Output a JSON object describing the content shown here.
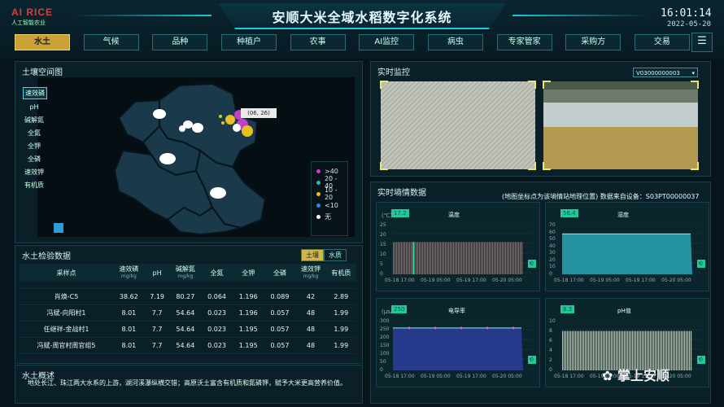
{
  "header": {
    "brand": "AI RICE",
    "brand_sub": "人工智能农业",
    "title": "安顺大米全域水稻数字化系统",
    "time": "16:01:14",
    "date": "2022-05-20"
  },
  "nav": {
    "tabs": [
      "水土",
      "气候",
      "品种",
      "种植户",
      "农事",
      "AI监控",
      "病虫",
      "专家管家",
      "采购方",
      "交易"
    ],
    "active": "水土"
  },
  "soil_map": {
    "title": "土壤空间图",
    "layers": [
      "速效磷",
      "pH",
      "碱解氮",
      "全氮",
      "全钾",
      "全磷",
      "速效钾",
      "有机质"
    ],
    "active_layer": "速效磷",
    "tooltip": "(06, 26)",
    "legend": [
      {
        "label": ">40",
        "color": "#c040c8"
      },
      {
        "label": "20 - 40",
        "color": "#20c0a0"
      },
      {
        "label": "10 - 20",
        "color": "#e8c020"
      },
      {
        "label": "<10",
        "color": "#2090e0"
      },
      {
        "label": "无",
        "color": "#ffffff"
      }
    ]
  },
  "soil_table": {
    "title": "水土检验数据",
    "toggle": [
      "土壤",
      "水质"
    ],
    "headers": [
      {
        "label": "采样点",
        "unit": ""
      },
      {
        "label": "速效磷",
        "unit": "mg/kg"
      },
      {
        "label": "pH",
        "unit": ""
      },
      {
        "label": "碱解氮",
        "unit": "mg/kg"
      },
      {
        "label": "全氮",
        "unit": ""
      },
      {
        "label": "全钾",
        "unit": ""
      },
      {
        "label": "全磷",
        "unit": ""
      },
      {
        "label": "速效钾",
        "unit": "mg/kg"
      },
      {
        "label": "有机质",
        "unit": ""
      }
    ],
    "rows": [
      [
        "肖焕-C5",
        "38.62",
        "7.19",
        "80.27",
        "0.064",
        "1.196",
        "0.089",
        "42",
        "2.89"
      ],
      [
        "冯斌-向阳村1",
        "8.01",
        "7.7",
        "54.64",
        "0.023",
        "1.196",
        "0.057",
        "48",
        "1.99"
      ],
      [
        "任继祥-金战村1",
        "8.01",
        "7.7",
        "54.64",
        "0.023",
        "1.195",
        "0.057",
        "48",
        "1.99"
      ],
      [
        "冯斌-周官村周官组5",
        "8.01",
        "7.7",
        "54.64",
        "0.023",
        "1.195",
        "0.057",
        "48",
        "1.99"
      ]
    ]
  },
  "overview": {
    "title": "水土概述",
    "text": "地处长江、珠江两大水系的上游，湖河溪瀑纵横交错；高原沃土富含有机质和氮磷钾，赋予大米更高营养价值。"
  },
  "monitor": {
    "title": "实时监控",
    "device": "V03000000003"
  },
  "sensor": {
    "title": "实时墒情数据",
    "note": "(地图坐标点为该墒情站地理位置) 数据来自设备：S03PT00000037",
    "charts": [
      {
        "title": "温度",
        "unit": "(℃)",
        "badge": "17.2",
        "end_value": "0",
        "x_ticks": [
          "05-18 17:00",
          "05-19 05:00",
          "05-19 17:00",
          "05-20 05:00"
        ],
        "y_ticks": [
          "25",
          "20",
          "15",
          "10",
          "5",
          "0"
        ]
      },
      {
        "title": "湿度",
        "unit": "",
        "badge": "56.4",
        "end_value": "0",
        "x_ticks": [
          "05-18 17:00",
          "05-19 05:00",
          "05-19 17:00",
          "05-20 05:00"
        ],
        "y_ticks": [
          "70",
          "60",
          "50",
          "40",
          "30",
          "20",
          "10",
          "0"
        ]
      },
      {
        "title": "电导率",
        "unit": "(μs/cm)",
        "badge": "250",
        "end_value": "0",
        "x_ticks": [
          "05-18 17:00",
          "05-19 05:00",
          "05-19 17:00",
          "05-20 05:00"
        ],
        "y_ticks": [
          "300",
          "250",
          "200",
          "150",
          "100",
          "50",
          "0"
        ]
      },
      {
        "title": "pH值",
        "unit": "",
        "badge": "8.3",
        "end_value": "0",
        "x_ticks": [
          "05-18 17:00",
          "05-19 05:00",
          "05-19 17:00",
          "05-20 05:00"
        ],
        "y_ticks": [
          "10",
          "8",
          "6",
          "4",
          "2",
          "0"
        ]
      }
    ]
  },
  "watermark": "掌上安顺",
  "colors": {
    "accent": "#1ec8d8",
    "active_tab": "#c9a336",
    "temp_bar": "#d8503c",
    "humidity_area": "#2aa6b8",
    "ec_area": "#2d3d9c",
    "ph_bar": "#d8c070"
  }
}
